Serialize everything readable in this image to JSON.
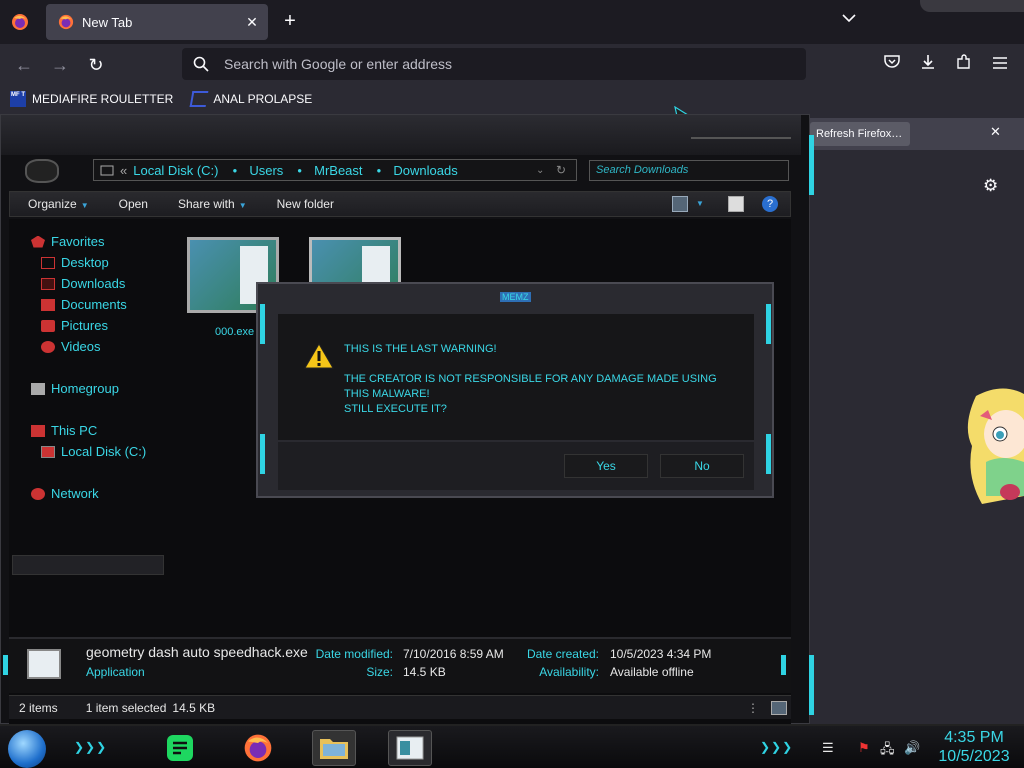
{
  "browser": {
    "tab_title": "New Tab",
    "url_placeholder": "Search with Google or enter address",
    "bookmarks": [
      {
        "label": "MEDIAFIRE ROULETTER",
        "icon": "mediafire-icon",
        "icon_text": "MF T"
      },
      {
        "label": "ANAL PROLAPSE",
        "icon": "bookmark-flag-icon"
      }
    ],
    "notification_button": "Refresh Firefox…"
  },
  "explorer": {
    "breadcrumb": [
      "Local Disk (C:)",
      "Users",
      "MrBeast",
      "Downloads"
    ],
    "breadcrumb_prefix": "«",
    "search_placeholder": "Search Downloads",
    "commands": [
      {
        "label": "Organize",
        "dropdown": true
      },
      {
        "label": "Open",
        "dropdown": false
      },
      {
        "label": "Share with",
        "dropdown": true
      },
      {
        "label": "New folder",
        "dropdown": false
      }
    ],
    "nav": {
      "favorites": "Favorites",
      "desktop": "Desktop",
      "downloads": "Downloads",
      "documents": "Documents",
      "pictures": "Pictures",
      "videos": "Videos",
      "homegroup": "Homegroup",
      "this_pc": "This PC",
      "local_disk": "Local Disk (C:)",
      "network": "Network"
    },
    "files": [
      {
        "name": "000.exe"
      },
      {
        "name": ""
      }
    ],
    "details": {
      "name": "geometry dash auto speedhack.exe",
      "type": "Application",
      "date_modified_label": "Date modified:",
      "date_modified": "7/10/2016 8:59 AM",
      "size_label": "Size:",
      "size": "14.5 KB",
      "date_created_label": "Date created:",
      "date_created": "10/5/2023 4:34 PM",
      "availability_label": "Availability:",
      "availability": "Available offline"
    },
    "status": {
      "items": "2 items",
      "selected": "1 item selected",
      "selected_size": "14.5 KB"
    }
  },
  "dialog": {
    "title": "MEMZ",
    "line1": "THIS IS THE LAST WARNING!",
    "line2": "THE CREATOR IS NOT RESPONSIBLE FOR ANY DAMAGE MADE USING",
    "line3": "THIS MALWARE!",
    "line4": "STILL EXECUTE IT?",
    "yes": "Yes",
    "no": "No"
  },
  "taskbar": {
    "time": "4:35 PM",
    "date": "10/5/2023",
    "deco": "❯❯❯"
  },
  "colors": {
    "accent": "#3ad7e6",
    "browser_bg": "#2b2a33"
  }
}
